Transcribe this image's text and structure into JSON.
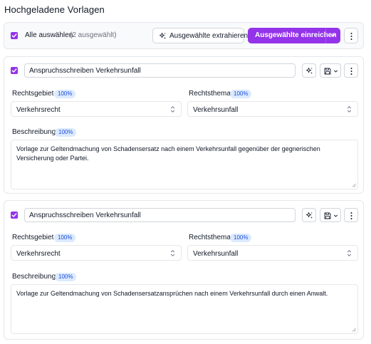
{
  "page_title": "Hochgeladene Vorlagen",
  "toolbar": {
    "select_all_label": "Alle auswählen",
    "selected_count": "(2 ausgewählt)",
    "extract_label": "Ausgewählte extrahieren",
    "submit_label": "Ausgewählte einreichen"
  },
  "templates": [
    {
      "title": "Anspruchsschreiben Verkehrsunfall",
      "checked": true,
      "legal_area_label": "Rechtsgebiet",
      "legal_area_confidence": "100%",
      "legal_area_value": "Verkehrsrecht",
      "legal_topic_label": "Rechtsthema",
      "legal_topic_confidence": "100%",
      "legal_topic_value": "Verkehrsunfall",
      "description_label": "Beschreibung",
      "description_confidence": "100%",
      "description_value": "Vorlage zur Geltendmachung von Schadensersatz nach einem Verkehrsunfall gegenüber der gegnerischen Versicherung oder Partei."
    },
    {
      "title": "Anspruchsschreiben Verkehrsunfall",
      "checked": true,
      "legal_area_label": "Rechtsgebiet",
      "legal_area_confidence": "100%",
      "legal_area_value": "Verkehrsrecht",
      "legal_topic_label": "Rechtsthema",
      "legal_topic_confidence": "100%",
      "legal_topic_value": "Verkehrsunfall",
      "description_label": "Beschreibung",
      "description_confidence": "100%",
      "description_value": "Vorlage zur Geltendmachung von Schadensersatzansprüchen nach einem Verkehrsunfall durch einen Anwalt."
    }
  ],
  "icons": {
    "checkbox": "checkmark-icon",
    "extract": "sparkles-icon",
    "save": "save-icon",
    "dropdown": "chevron-down-icon",
    "more": "more-vertical-icon",
    "select_arrows": "chevron-up-down-icon",
    "resize": "resize-grip-icon"
  },
  "colors": {
    "accent": "#9333ea",
    "badge_bg": "#dbeafe",
    "badge_text": "#1d4ed8",
    "border": "#e5e7eb",
    "toolbar_bg": "#f9fafb"
  }
}
